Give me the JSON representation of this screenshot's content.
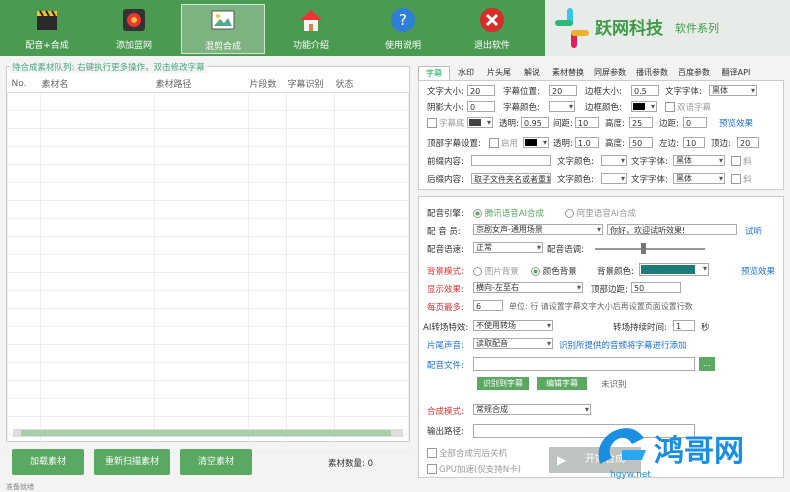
{
  "toolbar": {
    "btn1": "配音+合成",
    "btn2": "添加蓝网",
    "btn3": "混剪合成",
    "btn4": "功能介绍",
    "btn5": "使用说明",
    "btn6": "退出软件"
  },
  "brand": {
    "name": "跃网科技",
    "suffix": "软件系列"
  },
  "queue": {
    "legend": "待合成素材队列: 右键执行更多操作，双击修改字幕",
    "headers": [
      "No.",
      "素材名",
      "素材路径",
      "片段数",
      "字幕识别",
      "状态"
    ],
    "add": "加载素材",
    "rescan": "重新扫描素材",
    "clear": "清空素材",
    "count_label": "素材数量: 0"
  },
  "tabs": [
    "字幕",
    "水印",
    "片头尾",
    "解说",
    "素材替换",
    "同屏参数",
    "播讯参数",
    "百度参数",
    "翻译API"
  ],
  "sub": {
    "font_size_l": "文字大小:",
    "font_size": "20",
    "pos_l": "字幕位置:",
    "pos": "20",
    "border_l": "边框大小:",
    "border": "0.5",
    "font_l": "文字字体:",
    "font": "黑体",
    "shadow_l": "阴影大小:",
    "shadow": "0",
    "color_l": "字幕颜色:",
    "border_color_l": "边框颜色:",
    "dual": "双语字幕",
    "bg_l": "字幕底",
    "alpha_l": "透明:",
    "alpha": "0.95",
    "gap_l": "间距:",
    "gap": "10",
    "height_l": "高度:",
    "height": "25",
    "margin_l": "边距:",
    "margin": "0",
    "preview": "预览效果",
    "top_l": "顶部字幕设置:",
    "top_enable": "启用",
    "talpha_l": "透明:",
    "talpha": "1.0",
    "theight_l": "高度:",
    "theight": "50",
    "tmargin_l": "左边:",
    "tmargin": "10",
    "tdist_l": "顶边:",
    "tdist": "20",
    "front_l": "前缀内容:",
    "fcolor_l": "文字颜色:",
    "ffont_l": "文字字体:",
    "ffont": "黑体",
    "bold": "斜",
    "back_l": "后缀内容:",
    "back": "取子文件夹名或者重复",
    "bcolor_l": "文字颜色:",
    "bfont_l": "文字字体:",
    "bfont": "黑体",
    "bold2": "斜"
  },
  "dub": {
    "engine_l": "配音引擎:",
    "engine1": "腾讯语音AI合成",
    "engine2": "阿里语音AI合成",
    "voice_l": "配 音 员:",
    "voice": "京剧女声-通用场景",
    "sample": "你好，欢迎试听效果!",
    "listen": "试听",
    "speed_l": "配音语速:",
    "speed": "正常",
    "pitch_l": "配音语调:",
    "bgmode_l": "背景模式:",
    "bg1": "图片背景",
    "bg2": "颜色背景",
    "bgcolor_l": "背景颜色:",
    "pv": "预览效果",
    "effect_l": "显示效果:",
    "effect": "横向-左至右",
    "toppad_l": "顶部边距:",
    "toppad": "50",
    "lines_l": "每页最多:",
    "lines": "6",
    "lines_hint": "单位: 行 请设置字幕文字大小后再设置页面设置行数",
    "trans_l": "AI转场特效:",
    "trans": "不使用转场",
    "dur_l": "转场持续时间:",
    "dur": "1",
    "sec": "秒",
    "clip_l": "片尾声音:",
    "clip": "读取配音",
    "clip_hint": "识别所提供的音频将字幕进行添加",
    "file_l": "配音文件:",
    "recog": "识别到字幕",
    "edit": "编辑字幕",
    "unrec": "未识别",
    "mode_l": "合成模式:",
    "mode": "常规合成",
    "out_l": "输出路径:",
    "shutdown": "全部合成完后关机",
    "gpu": "GPU加速(仅支持N卡)",
    "start": "开始合成"
  },
  "watermark": {
    "name": "鸿哥网",
    "url": "hgyw.net"
  },
  "status": {
    "text": "准备就绪"
  }
}
